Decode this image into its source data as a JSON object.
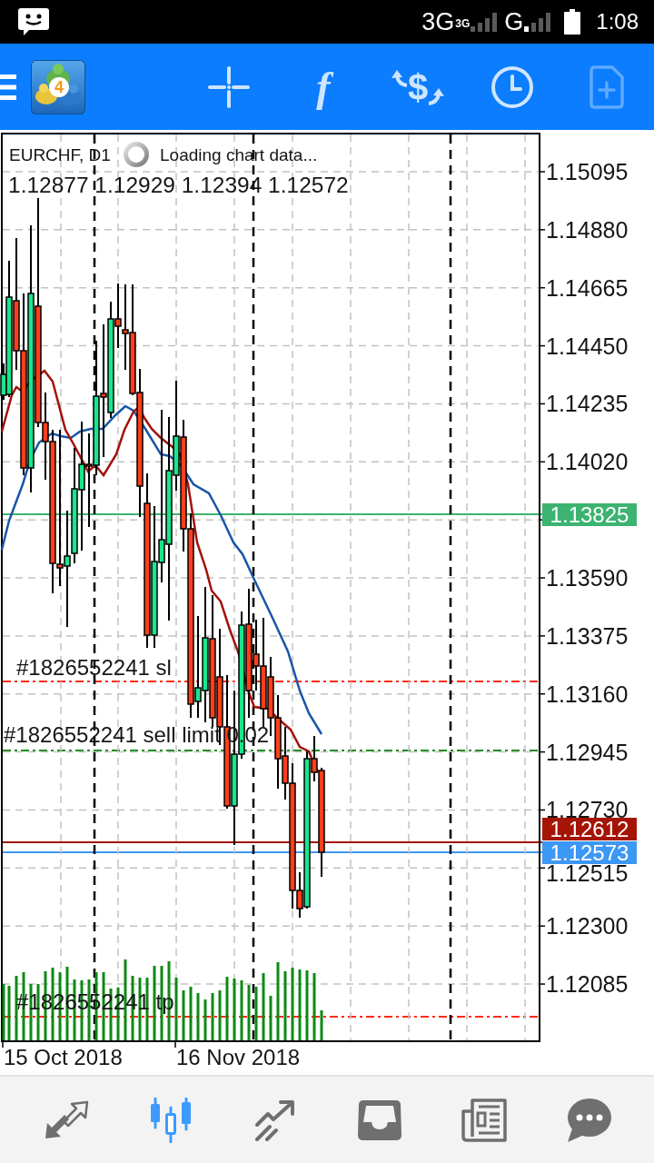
{
  "status_bar": {
    "network": "3G",
    "network_badge": "3G",
    "network_2": "G",
    "time": "1:08"
  },
  "toolbar": {
    "logo_badge": "4",
    "buttons": [
      {
        "kind": "crosshair",
        "disabled": false
      },
      {
        "kind": "indicators",
        "symbol": "f",
        "disabled": false
      },
      {
        "kind": "trade",
        "symbol": "$",
        "disabled": false
      },
      {
        "kind": "timeframe",
        "disabled": false
      },
      {
        "kind": "new-order",
        "disabled": true
      }
    ]
  },
  "chart": {
    "symbol": "EURCHF, D1",
    "loading_text": "Loading chart data...",
    "ohlc": "1.12877 1.12929 1.12394 1.12572",
    "order_lines": [
      {
        "kind": "stop-loss",
        "label": "#1826552241 sl",
        "color": "#ff2a0a"
      },
      {
        "kind": "sell-limit",
        "label": "#1826552241 sell limit 0.02",
        "color": "#138a13"
      },
      {
        "kind": "take-profit",
        "label": "#1826552241 tp",
        "color": "#ff2a0a"
      }
    ],
    "price_axis": [
      "1.15095",
      "1.14880",
      "1.14665",
      "1.14450",
      "1.14235",
      "1.14020",
      "1.13590",
      "1.13375",
      "1.13160",
      "1.12945",
      "1.12730",
      "1.12515",
      "1.12300",
      "1.12085"
    ],
    "price_tags": [
      {
        "kind": "horizontal-line",
        "text": "1.13825",
        "color": "#3cb371"
      },
      {
        "kind": "ask",
        "text": "1.12612",
        "color": "#a51505"
      },
      {
        "kind": "bid",
        "text": "1.12573",
        "color": "#3d97f4"
      }
    ],
    "date_axis": [
      "15 Oct 2018",
      "16 Nov 2018"
    ]
  },
  "bottom_nav": [
    {
      "kind": "quotes",
      "selected": false
    },
    {
      "kind": "chart",
      "selected": true
    },
    {
      "kind": "trade",
      "selected": false
    },
    {
      "kind": "history",
      "selected": false
    },
    {
      "kind": "news",
      "selected": false
    },
    {
      "kind": "chat",
      "selected": false
    }
  ]
}
